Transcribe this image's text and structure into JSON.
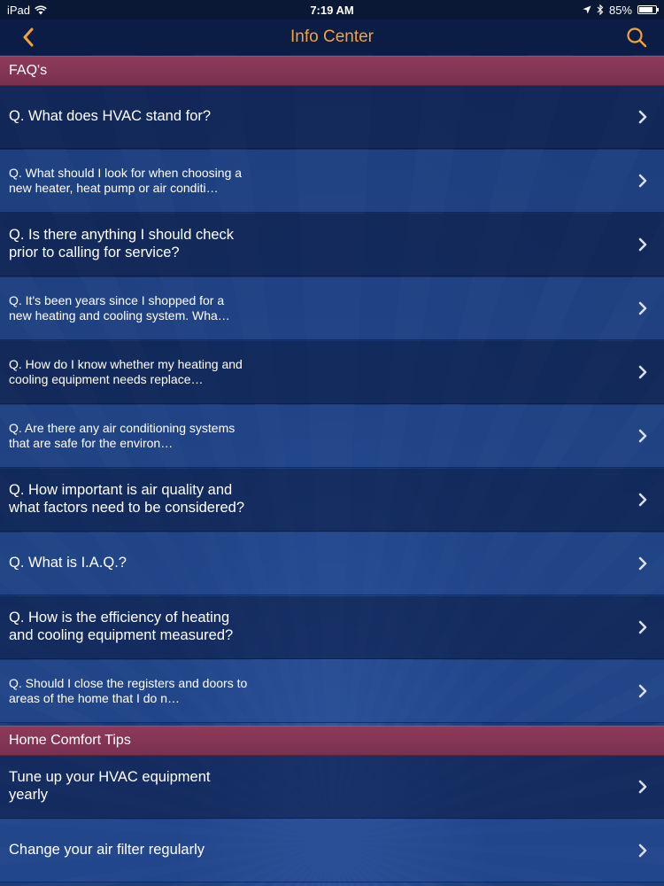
{
  "status_bar": {
    "device": "iPad",
    "time": "7:19 AM",
    "battery": "85%",
    "battery_level": 0.85
  },
  "nav": {
    "title": "Info Center",
    "back_icon": "chevron-left-icon",
    "search_icon": "search-icon"
  },
  "colors": {
    "title": "#f2a33a",
    "section_header": "#8e3a5a",
    "navbar": "#0b1d44"
  },
  "sections": {
    "faq": {
      "title": "FAQ's",
      "items": [
        "Q. What does HVAC stand for?",
        "Q. What should I look for when choosing a new heater, heat pump or air conditi…",
        "Q. Is there anything I should check prior to calling for service?",
        "Q. It's been years since I shopped for a new heating and cooling system. Wha…",
        "Q. How do I know whether my heating and cooling equipment needs replace…",
        "Q. Are there any air conditioning systems that are safe for the environ…",
        "Q. How important is air quality and what factors need to be considered?",
        "Q. What is I.A.Q.?",
        "Q. How is the efficiency of heating and cooling equipment measured?",
        "Q. Should I close the registers and doors to areas of the home that I do n…"
      ]
    },
    "tips": {
      "title": "Home Comfort Tips",
      "items": [
        "Tune up your HVAC equipment yearly",
        "Change your air filter regularly"
      ]
    }
  }
}
